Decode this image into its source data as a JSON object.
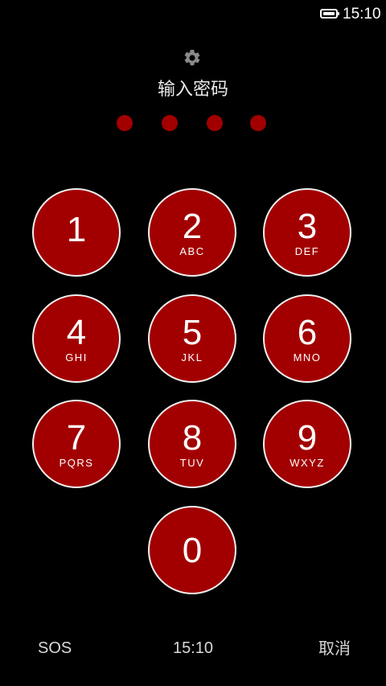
{
  "status_bar": {
    "battery_icon": "battery-icon",
    "time": "15:10"
  },
  "header": {
    "settings_icon": "gear-icon",
    "prompt": "输入密码"
  },
  "pin": {
    "length": 4,
    "entered": 0
  },
  "keypad": {
    "keys": [
      {
        "digit": "1",
        "letters": ""
      },
      {
        "digit": "2",
        "letters": "ABC"
      },
      {
        "digit": "3",
        "letters": "DEF"
      },
      {
        "digit": "4",
        "letters": "GHI"
      },
      {
        "digit": "5",
        "letters": "JKL"
      },
      {
        "digit": "6",
        "letters": "MNO"
      },
      {
        "digit": "7",
        "letters": "PQRS"
      },
      {
        "digit": "8",
        "letters": "TUV"
      },
      {
        "digit": "9",
        "letters": "WXYZ"
      },
      {
        "digit": "0",
        "letters": ""
      }
    ]
  },
  "bottom_bar": {
    "sos_label": "SOS",
    "time": "15:10",
    "cancel_label": "取消"
  },
  "colors": {
    "background": "#000000",
    "key_fill": "#a20000",
    "key_border": "#f0f0f0",
    "text": "#ffffff"
  }
}
